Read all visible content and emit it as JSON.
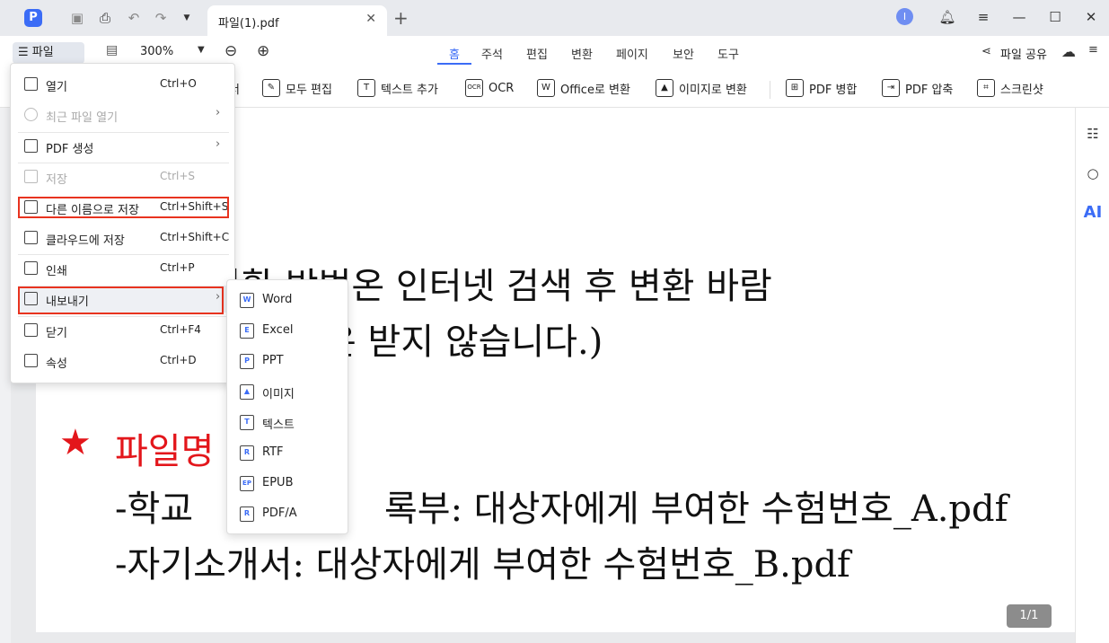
{
  "titlebar": {
    "tab_title": "파일(1).pdf",
    "user_initial": "I"
  },
  "ribbon": {
    "file_label": "파일",
    "zoom": "300%",
    "tabs": [
      "홈",
      "주석",
      "편집",
      "변환",
      "페이지",
      "보안",
      "도구"
    ],
    "active_tab": "홈",
    "share_label": "파일 공유",
    "tools": [
      {
        "label": "모두 편집",
        "icon": "edit-all-icon"
      },
      {
        "label": "텍스트 추가",
        "icon": "add-text-icon"
      },
      {
        "label": "OCR",
        "icon": "ocr-icon"
      },
      {
        "label": "Office로 변환",
        "icon": "office-convert-icon"
      },
      {
        "label": "이미지로 변환",
        "icon": "image-convert-icon"
      },
      {
        "label": "PDF 병합",
        "icon": "pdf-merge-icon"
      },
      {
        "label": "PDF 압축",
        "icon": "pdf-compress-icon"
      },
      {
        "label": "스크린샷",
        "icon": "screenshot-icon"
      }
    ],
    "partial_tool_char": "너"
  },
  "file_menu": {
    "items": [
      {
        "label": "열기",
        "shortcut": "Ctrl+O",
        "disabled": false,
        "arrow": false
      },
      {
        "label": "최근 파일 열기",
        "shortcut": "",
        "disabled": true,
        "arrow": true
      },
      {
        "label": "PDF 생성",
        "shortcut": "",
        "disabled": false,
        "arrow": true
      },
      {
        "label": "저장",
        "shortcut": "Ctrl+S",
        "disabled": true,
        "arrow": false
      },
      {
        "label": "다른 이름으로 저장",
        "shortcut": "Ctrl+Shift+S",
        "disabled": false,
        "arrow": false
      },
      {
        "label": "클라우드에 저장",
        "shortcut": "Ctrl+Shift+C",
        "disabled": false,
        "arrow": false
      },
      {
        "label": "인쇄",
        "shortcut": "Ctrl+P",
        "disabled": false,
        "arrow": false
      },
      {
        "label": "내보내기",
        "shortcut": "",
        "disabled": false,
        "arrow": true
      },
      {
        "label": "닫기",
        "shortcut": "Ctrl+F4",
        "disabled": false,
        "arrow": false
      },
      {
        "label": "속성",
        "shortcut": "Ctrl+D",
        "disabled": false,
        "arrow": false
      }
    ]
  },
  "export_menu": {
    "items": [
      {
        "label": "Word",
        "glyph": "W"
      },
      {
        "label": "Excel",
        "glyph": "E"
      },
      {
        "label": "PPT",
        "glyph": "P"
      },
      {
        "label": "이미지",
        "glyph": "▲"
      },
      {
        "label": "텍스트",
        "glyph": "T"
      },
      {
        "label": "RTF",
        "glyph": "R"
      },
      {
        "label": "EPUB",
        "glyph": "EP"
      },
      {
        "label": "PDF/A",
        "glyph": "R"
      }
    ]
  },
  "document": {
    "line1": "l 변환 방법온 인터넷 검색 후 변환 바람",
    "line2": "은 받지 않습니다.)",
    "star": "★",
    "line3_red": "파일명",
    "line4_left": "-학교",
    "line4_right": "록부: 대상자에게 부여한 수험번호_A.pdf",
    "line5": "-자기소개서: 대상자에게 부여한 수험번호_B.pdf"
  },
  "page_indicator": "1/1",
  "colors": {
    "accent": "#3b6cf6",
    "highlight": "#e8331f",
    "doc_red": "#e3161b"
  }
}
